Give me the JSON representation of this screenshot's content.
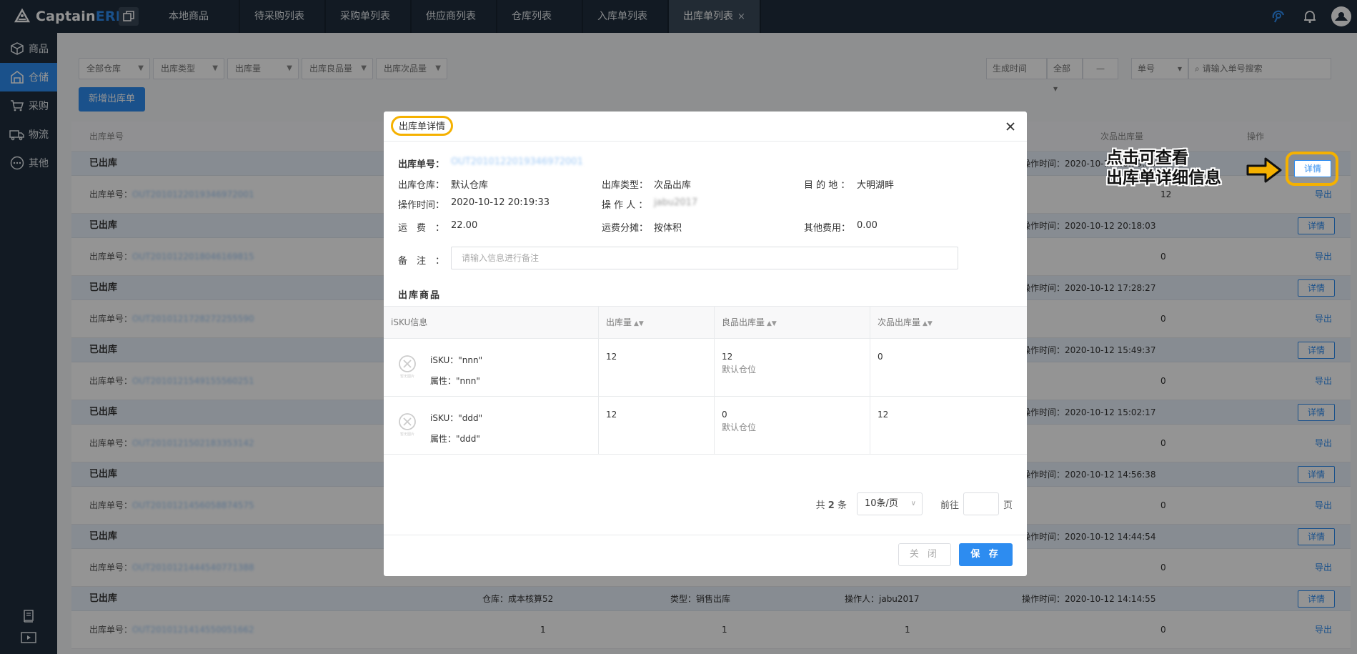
{
  "app": {
    "logo_prefix": "Captain",
    "logo_suffix": "ERP",
    "tabs": [
      {
        "label": "本地商品",
        "active": false
      },
      {
        "label": "待采购列表",
        "active": false
      },
      {
        "label": "采购单列表",
        "active": false
      },
      {
        "label": "供应商列表",
        "active": false
      },
      {
        "label": "仓库列表",
        "active": false
      },
      {
        "label": "入库单列表",
        "active": false
      },
      {
        "label": "出库单列表",
        "active": true
      }
    ],
    "tab_close": "×"
  },
  "sidebar": {
    "items": [
      {
        "label": "商品",
        "icon": "box-icon",
        "active": false
      },
      {
        "label": "仓储",
        "icon": "warehouse-icon",
        "active": true
      },
      {
        "label": "采购",
        "icon": "cart-icon",
        "active": false
      },
      {
        "label": "物流",
        "icon": "truck-icon",
        "active": false
      },
      {
        "label": "其他",
        "icon": "more-icon",
        "active": false
      }
    ]
  },
  "filters": {
    "selects": [
      "全部仓库",
      "出库类型",
      "出库量",
      "出库良品量",
      "出库次品量"
    ],
    "time_label": "生成时间",
    "time_all": "全部",
    "time_dash": "—",
    "search_type": "单号",
    "search_placeholder": "请输入单号搜索"
  },
  "add_button": "新增出库单",
  "list": {
    "col_order_no": "出库单号",
    "col_defect_qty": "次品出库量",
    "col_actions": "操作",
    "detail_label": "详情",
    "export_label": "导出",
    "order_prefix": "出库单号：",
    "groups": [
      {
        "status": "已出库",
        "time": "操作时间：2020-10-12 20:19:33",
        "order": "OUT2010122019346972001",
        "qty": "12"
      },
      {
        "status": "已出库",
        "time": "操作时间：2020-10-12 20:18:03",
        "order": "OUT2010122018046169815",
        "qty": "0"
      },
      {
        "status": "已出库",
        "time": "操作时间：2020-10-12 17:28:27",
        "order": "OUT2010121728272255590",
        "qty": "0"
      },
      {
        "status": "已出库",
        "time": "操作时间：2020-10-12 15:49:37",
        "order": "OUT2010121549155560251",
        "qty": "0"
      },
      {
        "status": "已出库",
        "time": "操作时间：2020-10-12 15:02:17",
        "order": "OUT2010121502183353142",
        "qty": "0"
      },
      {
        "status": "已出库",
        "time": "操作时间：2020-10-12 14:56:38",
        "order": "OUT2010121456058874575",
        "qty": "0"
      },
      {
        "status": "已出库",
        "time": "操作时间：2020-10-12 14:44:54",
        "order": "OUT2010121444540771388",
        "qty": "0"
      },
      {
        "status": "已出库",
        "time": "操作时间：2020-10-12 14:14:55",
        "order": "OUT2010121414550051662",
        "qty": "0",
        "warehouse": "仓库：成本核算52",
        "type": "类型：销售出库",
        "operator": "操作人：jabu2017",
        "n1": "1",
        "n2": "1",
        "n3": "1"
      }
    ]
  },
  "modal": {
    "title": "出库单详情",
    "order_label": "出库单号：",
    "order_value": "OUT2010122019346972001",
    "warehouse_label": "出库仓库：",
    "warehouse_value": "默认仓库",
    "type_label": "出库类型：",
    "type_value": "次品出库",
    "dest_label": "目 的 地 ：",
    "dest_value": "大明湖畔",
    "optime_label": "操作时间：",
    "optime_value": "2020-10-12 20:19:33",
    "operator_label": "操 作 人 ：",
    "operator_value": "jabu2017",
    "freight_label": "运　费　：",
    "freight_value": "22.00",
    "alloc_label": "运费分摊：",
    "alloc_value": "按体积",
    "other_label": "其他费用：",
    "other_value": "0.00",
    "remark_label": "备　注　：",
    "remark_placeholder": "请输入信息进行备注",
    "goods_title": "出库商品",
    "columns": [
      "iSKU信息",
      "出库量",
      "良品出库量",
      "次品出库量"
    ],
    "no_image_text": "暂无图片",
    "rows": [
      {
        "sku": "iSKU：\"nnn\"",
        "attr": "属性：\"nnn\"",
        "qty": "12",
        "good": "12",
        "good_loc": "默认仓位",
        "defect": "0"
      },
      {
        "sku": "iSKU：\"ddd\"",
        "attr": "属性：\"ddd\"",
        "qty": "12",
        "good": "0",
        "good_loc": "默认仓位",
        "defect": "12"
      }
    ],
    "pager": {
      "total_prefix": "共",
      "total": "2",
      "total_suffix": "条",
      "page_size": "10条/页",
      "goto_prefix": "前往",
      "goto_suffix": "页"
    },
    "close_button": "关 闭",
    "save_button": "保 存"
  },
  "annotation": {
    "line1": "点击可查看",
    "line2": "出库单详细信息",
    "button_label": "详情",
    "highlight_color": "#f5b100"
  },
  "colors": {
    "primary": "#2d8cf0",
    "sidebar_bg": "#1f2d3d",
    "highlight": "#f5b100"
  }
}
